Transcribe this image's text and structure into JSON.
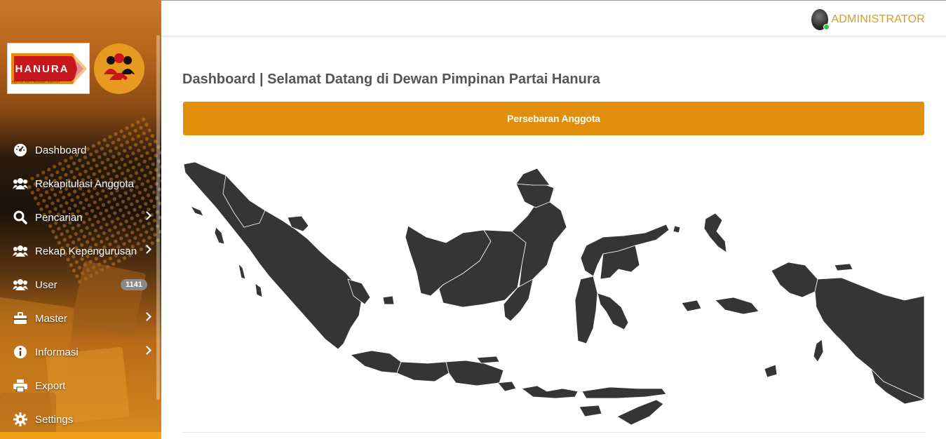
{
  "brand": {
    "logo_text": "HANURA",
    "logo_tagline": "PARTAI HATI NURANI RAKYAT",
    "accent": "#e08e0b"
  },
  "sidebar": {
    "items": [
      {
        "label": "Dashboard",
        "icon": "dashboard-icon",
        "has_submenu": false
      },
      {
        "label": "Rekapitulasi Anggota",
        "icon": "users-icon",
        "has_submenu": false
      },
      {
        "label": "Pencarian",
        "icon": "search-icon",
        "has_submenu": true
      },
      {
        "label": "Rekap Kepengurusan",
        "icon": "users-icon",
        "has_submenu": true
      },
      {
        "label": "User",
        "icon": "users-icon",
        "has_submenu": false,
        "badge": "1141"
      },
      {
        "label": "Master",
        "icon": "briefcase-icon",
        "has_submenu": true
      },
      {
        "label": "Informasi",
        "icon": "info-icon",
        "has_submenu": true
      },
      {
        "label": "Export",
        "icon": "printer-icon",
        "has_submenu": false
      },
      {
        "label": "Settings",
        "icon": "gear-icon",
        "has_submenu": false
      }
    ]
  },
  "header": {
    "user_name": "ADMINISTRATOR",
    "user_color": "#d79a25",
    "status": "online"
  },
  "main": {
    "page_title": "Dashboard | Selamat Datang di Dewan Pimpinan Partai Hanura",
    "panel_title": "Persebaran Anggota",
    "map": {
      "fill_color": "#353535",
      "subject": "indonesia-province-map"
    }
  }
}
